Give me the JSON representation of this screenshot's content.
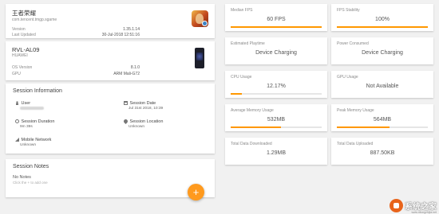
{
  "app": {
    "name": "王者荣耀",
    "package": "com.tencent.tmgp.sgame",
    "version_label": "Version",
    "version": "1.35.1.14",
    "updated_label": "Last Updated",
    "updated": "30-Jul-2018 12:51:16"
  },
  "device": {
    "model": "RVL-AL09",
    "brand": "HUAWEI",
    "os_label": "OS Version",
    "os": "8.1.0",
    "gpu_label": "GPU",
    "gpu": "ARM Mali-G72"
  },
  "session": {
    "title": "Session Information",
    "user_label": "User",
    "date_label": "Session Date",
    "date": "Jul 31st 2018, 10:39",
    "duration_label": "Session Duration",
    "duration": "9m 39s",
    "location_label": "Session Location",
    "location": "Unknown",
    "network_label": "Mobile Network",
    "network": "Unknown"
  },
  "notes": {
    "title": "Session Notes",
    "empty": "No Notes",
    "hint": "Click the + to add one"
  },
  "fab": {
    "label": "+"
  },
  "metrics": [
    {
      "label": "Median FPS",
      "value": "60 FPS",
      "fill": 1.0
    },
    {
      "label": "FPS Stability",
      "value": "100%",
      "fill": 1.0
    },
    {
      "label": "Estimated Playtime",
      "value": "Device Charging",
      "fill": 0
    },
    {
      "label": "Power Consumed",
      "value": "Device Charging",
      "fill": 0
    },
    {
      "label": "CPU Usage",
      "value": "12.17%",
      "fill": 0.12
    },
    {
      "label": "GPU Usage",
      "value": "Not Available",
      "fill": 0
    },
    {
      "label": "Average Memory Usage",
      "value": "532MB",
      "fill": 0.55
    },
    {
      "label": "Peak Memory Usage",
      "value": "564MB",
      "fill": 0.58
    },
    {
      "label": "Total Data Downloaded",
      "value": "1.29MB",
      "fill": 0
    },
    {
      "label": "Total Data Uploaded",
      "value": "887.50KB",
      "fill": 0
    }
  ],
  "watermark": {
    "text": "系统之家",
    "url": "www.xitongzhijia.net"
  },
  "colors": {
    "accent": "#ff9800",
    "fab": "#ff9a1e"
  }
}
